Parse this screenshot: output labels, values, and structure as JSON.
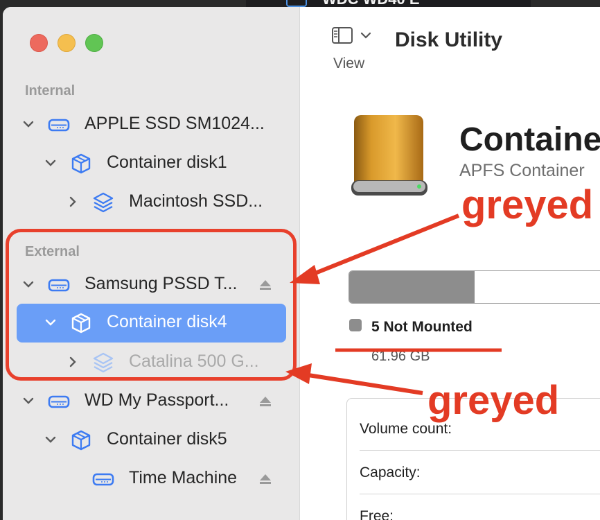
{
  "app": {
    "title": "Disk Utility",
    "view_label": "View"
  },
  "background_window": {
    "title_fragment": "WDC WD40 E"
  },
  "sidebar": {
    "sections": [
      {
        "label": "Internal"
      },
      {
        "label": "External"
      }
    ],
    "items": [
      {
        "label": "APPLE SSD SM1024...",
        "icon": "hard-drive-icon",
        "expanded": true
      },
      {
        "label": "Container disk1",
        "icon": "container-cube-icon",
        "expanded": true
      },
      {
        "label": "Macintosh SSD...",
        "icon": "volume-stack-icon",
        "expanded": false
      },
      {
        "label": "Samsung PSSD T...",
        "icon": "hard-drive-icon",
        "expanded": true,
        "eject": true
      },
      {
        "label": "Container disk4",
        "icon": "container-cube-icon",
        "expanded": true,
        "selected": true
      },
      {
        "label": "Catalina 500 G...",
        "icon": "volume-stack-icon",
        "expanded": false,
        "greyed": true
      },
      {
        "label": "WD My Passport...",
        "icon": "hard-drive-icon",
        "expanded": true,
        "eject": true
      },
      {
        "label": "Container disk5",
        "icon": "container-cube-icon",
        "expanded": true
      },
      {
        "label": "Time Machine",
        "icon": "hard-drive-icon",
        "eject": true
      }
    ]
  },
  "detail": {
    "title": "Containe",
    "subtitle": "APFS Container",
    "usage_fraction": 0.43,
    "legend_label": "5 Not Mounted",
    "legend_size": "61.96 GB",
    "info_rows": [
      {
        "key": "Volume count:"
      },
      {
        "key": "Capacity:"
      },
      {
        "key": "Free:"
      }
    ]
  },
  "annotations": {
    "note_top": "greyed",
    "note_bottom": "greyed",
    "color": "#e33b24"
  },
  "colors": {
    "accent": "#6a9ef7",
    "icon_blue": "#3d7bf2",
    "sidebar_bg": "#e9e8e8"
  }
}
